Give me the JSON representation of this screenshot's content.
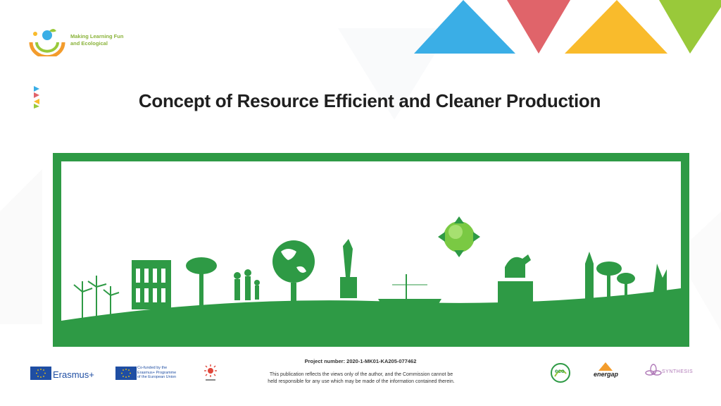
{
  "brand": {
    "logo_line1": "Making Learning Fun",
    "logo_line2": "and Ecological"
  },
  "slide": {
    "title": "Concept of Resource Efficient and Cleaner Production"
  },
  "footer": {
    "project_number": "Project number: 2020-1-MK01-KA205-077462",
    "disclaimer_line1": "This publication reflects the views only of the author, and the Commission cannot be",
    "disclaimer_line2": "held responsible for any use which may be made of the information contained therein.",
    "erasmus_label": "Erasmus+",
    "cofund_line1": "Co-funded by the",
    "cofund_line2": "Erasmus+ Programme",
    "cofund_line3": "of the European Union",
    "partner_eco": "eco",
    "partner_energap": "energap",
    "partner_synthesis": "SYNTHESIS"
  },
  "colors": {
    "tri_blue": "#3aaee6",
    "tri_red": "#e0646a",
    "tri_yellow": "#f9bb2c",
    "tri_green": "#99c93a",
    "banner_green": "#2e9a45"
  }
}
